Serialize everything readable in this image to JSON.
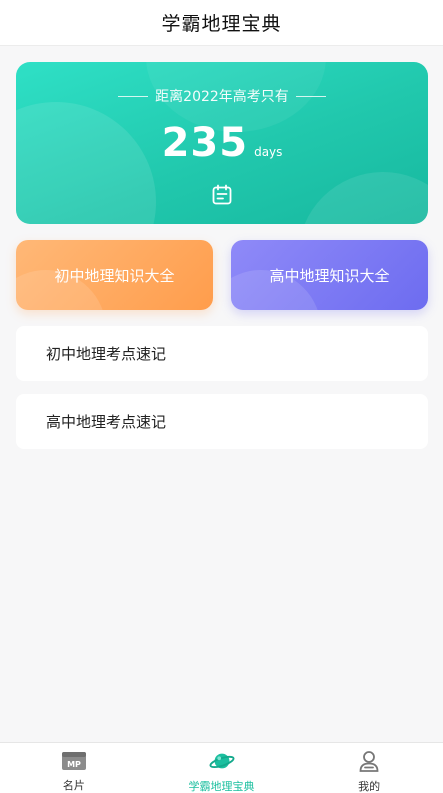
{
  "header": {
    "title": "学霸地理宝典"
  },
  "countdown": {
    "subtitle": "距离2022年高考只有",
    "days": "235",
    "unit": "days",
    "icon": "calendar-icon"
  },
  "buttons": {
    "junior": "初中地理知识大全",
    "senior": "高中地理知识大全"
  },
  "list": [
    {
      "label": "初中地理考点速记"
    },
    {
      "label": "高中地理考点速记"
    }
  ],
  "tabbar": {
    "items": [
      {
        "label": "名片",
        "icon": "mp-card-icon",
        "badge": "MP"
      },
      {
        "label": "学霸地理宝典",
        "icon": "planet-icon",
        "active": true
      },
      {
        "label": "我的",
        "icon": "user-icon"
      }
    ]
  },
  "colors": {
    "accent": "#1bbf9f",
    "countdown_start": "#2fe0c6",
    "countdown_end": "#17b89f",
    "junior_start": "#ffb877",
    "junior_end": "#ff9d4c",
    "senior_start": "#8f8af8",
    "senior_end": "#6d6cf0"
  }
}
